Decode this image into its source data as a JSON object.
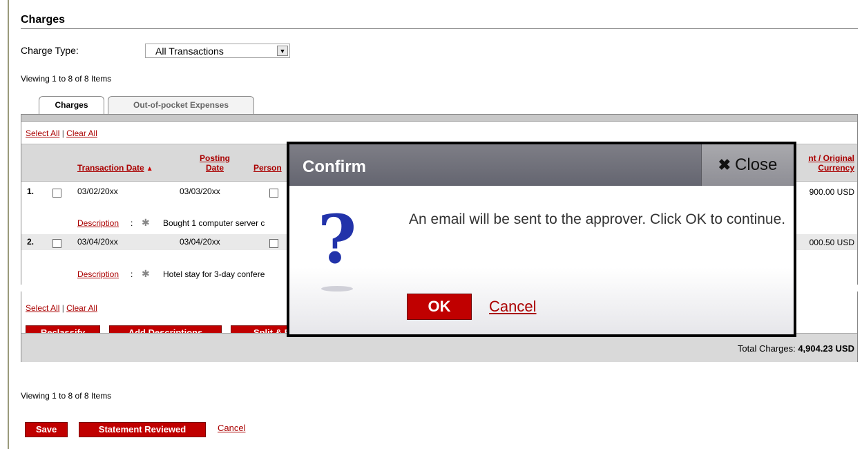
{
  "section": {
    "title": "Charges"
  },
  "filter": {
    "label": "Charge Type:",
    "selected": "All Transactions"
  },
  "viewing": {
    "top": "Viewing 1 to 8 of 8 Items",
    "bottom": "Viewing 1 to 8 of 8 Items"
  },
  "tabs": [
    {
      "label": "Charges",
      "active": true
    },
    {
      "label": "Out-of-pocket Expenses",
      "active": false
    }
  ],
  "selection": {
    "select_all": "Select All",
    "separator": "|",
    "clear_all": "Clear All"
  },
  "columns": {
    "transaction_date": "Transaction Date",
    "posting_date_l1": "Posting",
    "posting_date_l2": "Date",
    "personal": "Person",
    "amount_l1": "nt / Original",
    "amount_l2": "Currency"
  },
  "rows": [
    {
      "num": "1.",
      "transaction_date": "03/02/20xx",
      "posting_date": "03/03/20xx",
      "amount": "900.00 USD",
      "description_label": "Description",
      "description": "Bought 1 computer server c"
    },
    {
      "num": "2.",
      "transaction_date": "03/04/20xx",
      "posting_date": "03/04/20xx",
      "amount": "000.50 USD",
      "description_label": "Description",
      "description": "Hotel stay for 3-day confere"
    }
  ],
  "actions": {
    "reclassify": "Reclassify",
    "add_descriptions": "Add Descriptions",
    "split_reclassify": "Split & Reclassify"
  },
  "totals": {
    "label": "Total Charges:",
    "value": "4,904.23 USD"
  },
  "footer_buttons": {
    "save": "Save",
    "statement_reviewed": "Statement Reviewed",
    "cancel": "Cancel"
  },
  "modal": {
    "title": "Confirm",
    "close_label": "Close",
    "message": "An email will be sent to the approver. Click OK to continue.",
    "ok": "OK",
    "cancel": "Cancel"
  },
  "colors": {
    "brand_red": "#c00000",
    "link_red": "#aa0000",
    "header_gray": "#d9d9d9",
    "modal_head": "#6e6e76"
  },
  "icons": {
    "dropdown": "chevron-down-icon",
    "sort": "sort-ascending-icon",
    "star": "star-icon",
    "close": "close-icon",
    "question": "question-mark-icon"
  }
}
